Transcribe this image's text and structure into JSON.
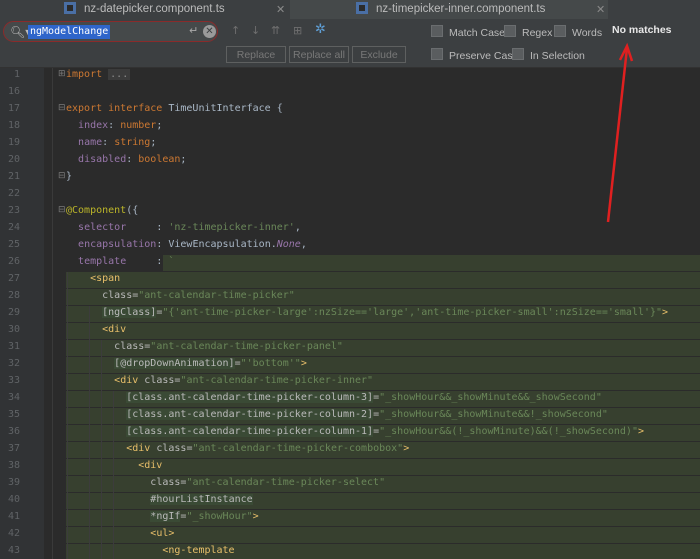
{
  "tabs": [
    {
      "label": "nz-datepicker.component.ts",
      "active": false
    },
    {
      "label": "nz-timepicker-inner.component.ts",
      "active": true
    }
  ],
  "find": {
    "query": "ngModelChange",
    "replace_label": "Replace",
    "replace_all_label": "Replace all",
    "exclude_label": "Exclude",
    "match_case_label": "Match Case",
    "regex_label": "Regex",
    "words_label": "Words",
    "preserve_case_label": "Preserve Case",
    "in_selection_label": "In Selection",
    "status": "No matches"
  },
  "colors": {
    "accent": "#4a88c7",
    "annotation_arrow": "#e02020",
    "error_border": "#8a2b2b"
  },
  "code": {
    "l1": "1",
    "l16": "16",
    "l17": "17",
    "l18": "18",
    "l19": "19",
    "l20": "20",
    "l21": "21",
    "l22": "22",
    "l23": "23",
    "l24": "24",
    "l25": "25",
    "l26": "26",
    "l27": "27",
    "l28": "28",
    "l29": "29",
    "l30": "30",
    "l31": "31",
    "l32": "32",
    "l33": "33",
    "l34": "34",
    "l35": "35",
    "l36": "36",
    "l37": "37",
    "l38": "38",
    "l39": "39",
    "l40": "40",
    "l41": "41",
    "l42": "42",
    "l43": "43"
  }
}
